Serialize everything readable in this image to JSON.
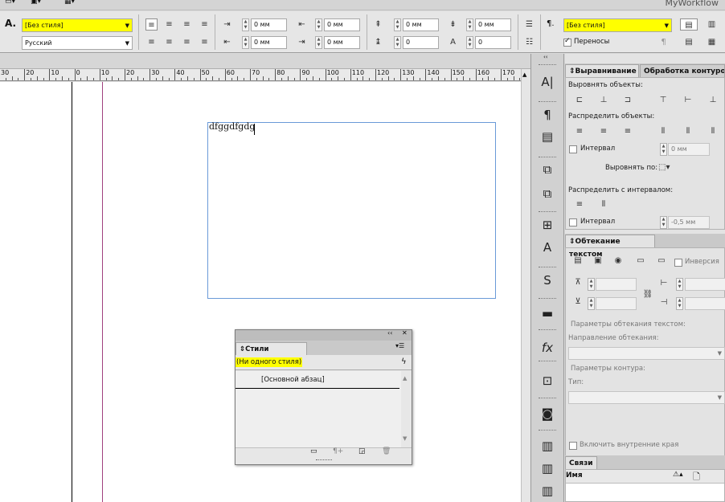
{
  "app": {
    "workflow": "MyWorkflow"
  },
  "control": {
    "char_style": "[Без стиля]",
    "language": "Русский",
    "indents": [
      "0 мм",
      "0 мм",
      "0 мм",
      "0 мм"
    ],
    "spacing": [
      "0 мм",
      "0 мм",
      "0",
      "0"
    ],
    "para_style": "[Без стиля]",
    "hyphenation_label": "Переносы",
    "icons": {
      "char_style": "A.",
      "para_style": "¶."
    }
  },
  "ruler": {
    "labels": [
      "30",
      "20",
      "10",
      "0",
      "10",
      "20",
      "30",
      "40",
      "50",
      "60",
      "70",
      "80",
      "90",
      "100",
      "110",
      "120",
      "130",
      "140",
      "150",
      "160",
      "170"
    ]
  },
  "document": {
    "text": "dfggdfgdg"
  },
  "align_panel": {
    "tab_align": "Выравнивание",
    "tab_pathfinder": "Обработка контуров",
    "align_objects": "Выровнять объекты:",
    "distribute_objects": "Распределить объекты:",
    "interval_label": "Интервал",
    "interval_value": "0 мм",
    "align_to": "Выровнять по:",
    "distribute_spacing": "Распределить с интервалом:",
    "interval2_label": "Интервал",
    "interval2_value": "-0,5 мм"
  },
  "wrap_panel": {
    "title": "Обтекание текстом",
    "invert": "Инверсия",
    "wrap_options": "Параметры обтекания текстом:",
    "wrap_direction": "Направление обтекания:",
    "contour_options": "Параметры контура:",
    "type": "Тип:",
    "inside_edges": "Включить внутренние края"
  },
  "links_panel": {
    "title": "Связи",
    "name_col": "Имя"
  },
  "styles_panel": {
    "title": "Стили абзацев",
    "current": "(Ни одного стиля)",
    "items": [
      "[Основной абзац]"
    ]
  },
  "colors": {
    "highlight": "#ffff00",
    "frame": "#6a9ad8",
    "margin": "#a0417f"
  }
}
